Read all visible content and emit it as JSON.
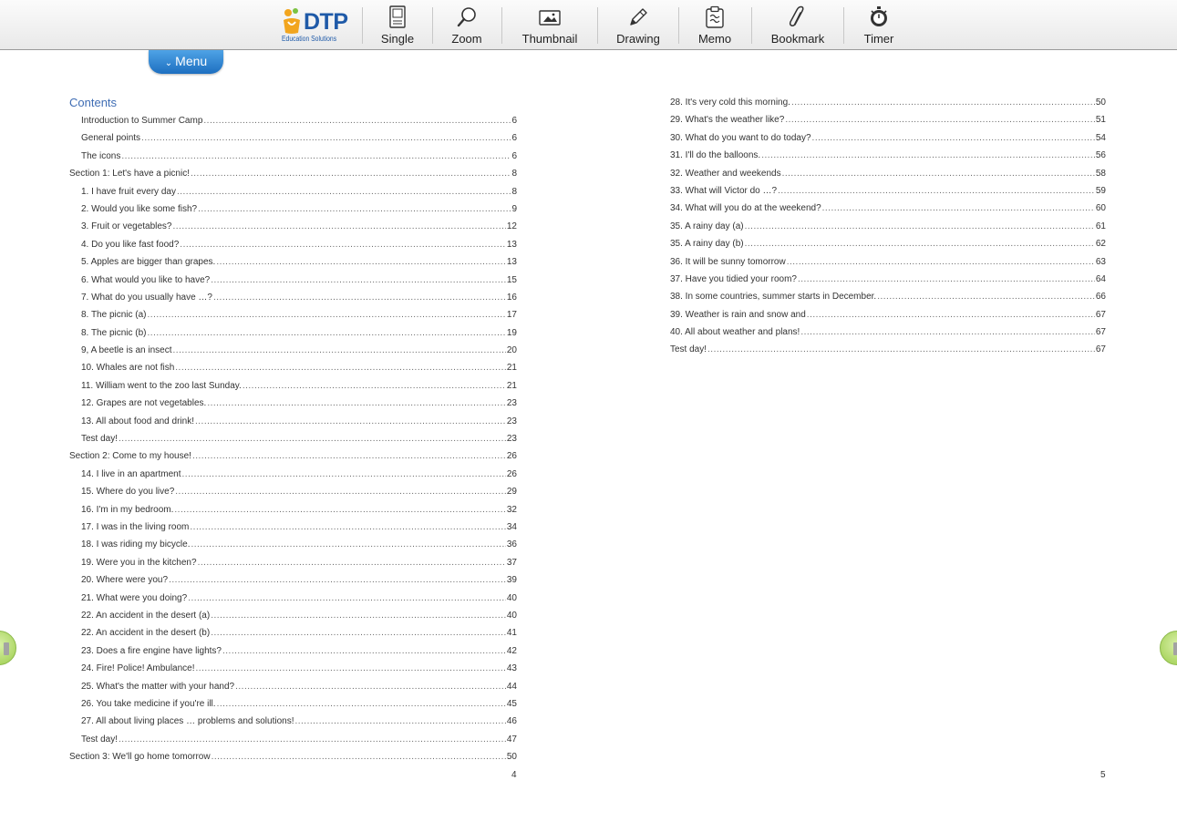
{
  "toolbar": {
    "logo_text": "DTP",
    "logo_sub": "Education Solutions",
    "tools": [
      {
        "label": "Single",
        "icon": "single-page-icon"
      },
      {
        "label": "Zoom",
        "icon": "zoom-icon"
      },
      {
        "label": "Thumbnail",
        "icon": "thumbnail-icon"
      },
      {
        "label": "Drawing",
        "icon": "pencil-icon"
      },
      {
        "label": "Memo",
        "icon": "memo-icon"
      },
      {
        "label": "Bookmark",
        "icon": "paperclip-icon"
      },
      {
        "label": "Timer",
        "icon": "stopwatch-icon"
      }
    ]
  },
  "menu": {
    "label": "Menu",
    "icon": "chevron-down-icon"
  },
  "colors": {
    "accent": "#1d6fc0",
    "logo": "#1f5aa8",
    "heading": "#3f6db4",
    "nav_green": "#9ccd4c"
  },
  "left_page": {
    "title": "Contents",
    "page_number": "4",
    "entries": [
      {
        "text": "Introduction to Summer Camp",
        "page": "6",
        "indent": true
      },
      {
        "text": "General points",
        "page": "6",
        "indent": true
      },
      {
        "text": "The icons",
        "page": "6",
        "indent": true
      },
      {
        "text": "Section 1: Let's have a picnic!",
        "page": "8",
        "indent": false
      },
      {
        "text": "1. I have fruit every day",
        "page": "8",
        "indent": true
      },
      {
        "text": "2. Would you like some fish?",
        "page": "9",
        "indent": true
      },
      {
        "text": "3. Fruit or vegetables?",
        "page": "12",
        "indent": true
      },
      {
        "text": "4. Do you like fast food?",
        "page": "13",
        "indent": true
      },
      {
        "text": "5. Apples are bigger than grapes.",
        "page": "13",
        "indent": true
      },
      {
        "text": "6. What would you like to have?",
        "page": "15",
        "indent": true
      },
      {
        "text": "7. What do you usually have …?",
        "page": "16",
        "indent": true
      },
      {
        "text": "8. The picnic (a)",
        "page": "17",
        "indent": true
      },
      {
        "text": "8. The picnic (b)",
        "page": "19",
        "indent": true
      },
      {
        "text": "9, A beetle is an insect",
        "page": "20",
        "indent": true
      },
      {
        "text": "10. Whales are not fish",
        "page": "21",
        "indent": true
      },
      {
        "text": "11. William went to the zoo last Sunday.",
        "page": "21",
        "indent": true
      },
      {
        "text": "12. Grapes are not vegetables.",
        "page": "23",
        "indent": true
      },
      {
        "text": "13. All about food and drink!",
        "page": "23",
        "indent": true
      },
      {
        "text": "Test day!",
        "page": "23",
        "indent": true
      },
      {
        "text": "Section 2: Come to my house!",
        "page": "26",
        "indent": false
      },
      {
        "text": "14. I live in an apartment",
        "page": "26",
        "indent": true
      },
      {
        "text": "15. Where do you live?",
        "page": "29",
        "indent": true
      },
      {
        "text": "16. I'm in my bedroom.",
        "page": "32",
        "indent": true
      },
      {
        "text": "17. I was in the living room",
        "page": "34",
        "indent": true
      },
      {
        "text": "18. I was riding my bicycle.",
        "page": "36",
        "indent": true
      },
      {
        "text": "19. Were you in the kitchen?",
        "page": "37",
        "indent": true
      },
      {
        "text": "20. Where were you?",
        "page": "39",
        "indent": true
      },
      {
        "text": "21. What were you doing?",
        "page": "40",
        "indent": true
      },
      {
        "text": "22. An accident in the desert (a)",
        "page": "40",
        "indent": true
      },
      {
        "text": "22. An accident in the desert (b)",
        "page": "41",
        "indent": true
      },
      {
        "text": "23. Does a fire engine have lights?",
        "page": "42",
        "indent": true
      },
      {
        "text": "24. Fire! Police! Ambulance!",
        "page": "43",
        "indent": true
      },
      {
        "text": "25. What's the matter with your hand?",
        "page": "44",
        "indent": true
      },
      {
        "text": "26. You take medicine if you're ill.",
        "page": "45",
        "indent": true
      },
      {
        "text": "27. All about living places … problems and solutions!",
        "page": "46",
        "indent": true
      },
      {
        "text": "Test day!",
        "page": "47",
        "indent": true
      },
      {
        "text": "Section 3: We'll go home tomorrow",
        "page": "50",
        "indent": false
      }
    ]
  },
  "right_page": {
    "page_number": "5",
    "entries": [
      {
        "text": "28. It's very cold this morning.",
        "page": "50"
      },
      {
        "text": "29. What's the weather like?",
        "page": "51"
      },
      {
        "text": "30. What do you want to do today?",
        "page": "54"
      },
      {
        "text": "31. I'll do the balloons.",
        "page": "56"
      },
      {
        "text": "32. Weather and weekends",
        "page": "58"
      },
      {
        "text": "33. What will Victor do …?",
        "page": "59"
      },
      {
        "text": "34. What will you do at the weekend?",
        "page": "60"
      },
      {
        "text": "35. A rainy day (a)",
        "page": "61"
      },
      {
        "text": "35. A rainy day (b)",
        "page": "62"
      },
      {
        "text": "36. It will be sunny tomorrow",
        "page": "63"
      },
      {
        "text": "37. Have you tidied your room?",
        "page": "64"
      },
      {
        "text": "38. In some countries, summer starts in December.",
        "page": "66"
      },
      {
        "text": "39. Weather is rain and snow and",
        "page": "67"
      },
      {
        "text": "40. All about weather and plans!",
        "page": "67"
      },
      {
        "text": "Test day!",
        "page": "67"
      }
    ]
  }
}
